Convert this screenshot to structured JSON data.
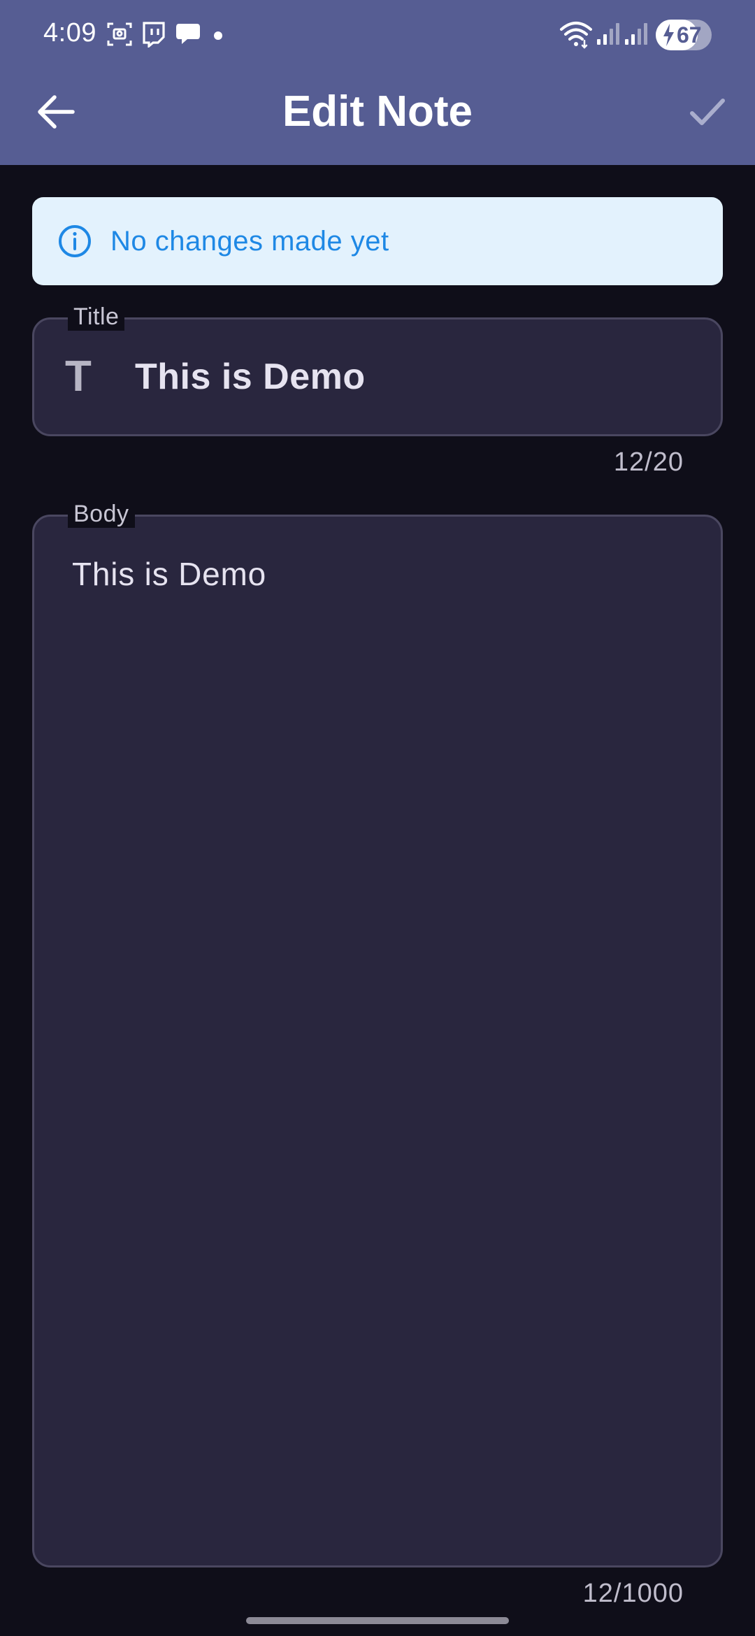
{
  "status_bar": {
    "time": "4:09",
    "battery": "67",
    "icons": [
      "screenshot-icon",
      "twitch-icon",
      "chat-bubble-icon",
      "dot-icon",
      "wifi-icon",
      "signal-icon",
      "signal-icon",
      "battery-charging-icon"
    ]
  },
  "toolbar": {
    "title": "Edit Note",
    "back_icon": "arrow-back-icon",
    "confirm_icon": "check-icon"
  },
  "info_banner": {
    "icon": "info-icon",
    "text": "No changes made yet"
  },
  "title_field": {
    "label": "Title",
    "icon": "T",
    "value": "This is Demo",
    "counter": "12/20"
  },
  "body_field": {
    "label": "Body",
    "value": "This is Demo",
    "counter": "12/1000"
  },
  "colors": {
    "app_bar": "#565d93",
    "background": "#0f0e19",
    "field_fill": "#29263e",
    "info_background": "#e3f2fd",
    "info_accent": "#1e88e5"
  }
}
